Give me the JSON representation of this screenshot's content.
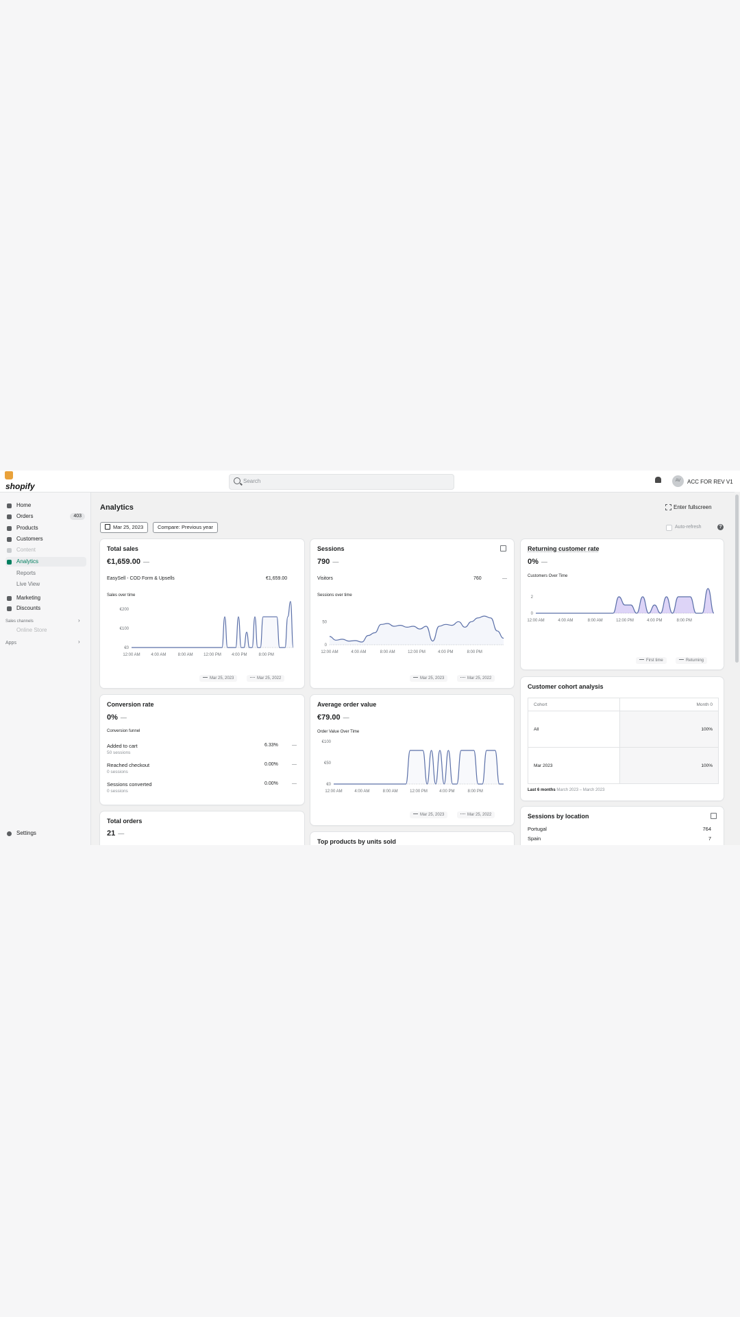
{
  "topbar": {
    "logo_text": "shopify",
    "search_placeholder": "Search",
    "avatar_initials": "AV",
    "store_name": "ACC FOR REV V1"
  },
  "sidebar": {
    "items": [
      {
        "label": "Home",
        "icon": "home-icon"
      },
      {
        "label": "Orders",
        "icon": "orders-icon",
        "badge": "403"
      },
      {
        "label": "Products",
        "icon": "tag-icon"
      },
      {
        "label": "Customers",
        "icon": "person-icon"
      },
      {
        "label": "Content",
        "icon": "content-icon"
      },
      {
        "label": "Analytics",
        "icon": "bar-chart-icon"
      },
      {
        "label": "Marketing",
        "icon": "target-icon"
      },
      {
        "label": "Discounts",
        "icon": "discount-icon"
      }
    ],
    "analytics_sub": [
      "Reports",
      "Live View"
    ],
    "sales_channels_label": "Sales channels",
    "online_store": "Online Store",
    "apps_label": "Apps",
    "settings": "Settings"
  },
  "header": {
    "title": "Analytics",
    "fullscreen": "Enter fullscreen",
    "date_button": "Mar 25, 2023",
    "compare_button": "Compare: Previous year",
    "auto_refresh": "Auto-refresh",
    "help": "?"
  },
  "legend": {
    "current": "Mar 25, 2023",
    "previous": "Mar 25, 2022"
  },
  "returning_legend": {
    "first": "First time",
    "returning": "Returning"
  },
  "total_sales": {
    "title": "Total sales",
    "value": "€1,659.00",
    "dash": "—",
    "source_label": "EasySell - COD Form & Upsells",
    "source_value": "€1,659.00",
    "chart_title": "Sales over time"
  },
  "sessions": {
    "title": "Sessions",
    "value": "790",
    "dash": "—",
    "visitors_label": "Visitors",
    "visitors_value": "760",
    "chart_title": "Sessions over time"
  },
  "returning": {
    "title": "Returning customer rate",
    "value": "0%",
    "dash": "—",
    "chart_title": "Customers Over Time"
  },
  "conversion": {
    "title": "Conversion rate",
    "value": "0%",
    "dash": "—",
    "funnel_title": "Conversion funnel",
    "rows": [
      {
        "label": "Added to cart",
        "sub": "50 sessions",
        "pct": "6.33%",
        "dash": "—"
      },
      {
        "label": "Reached checkout",
        "sub": "0 sessions",
        "pct": "0.00%",
        "dash": "—"
      },
      {
        "label": "Sessions converted",
        "sub": "0 sessions",
        "pct": "0.00%",
        "dash": "—"
      }
    ]
  },
  "aov": {
    "title": "Average order value",
    "value": "€79.00",
    "dash": "—",
    "chart_title": "Order Value Over Time"
  },
  "cohort": {
    "title": "Customer cohort analysis",
    "col_cohort": "Cohort",
    "col_month": "Month 0",
    "rows": [
      {
        "label": "All",
        "value": "100%"
      },
      {
        "label": "Mar 2023",
        "value": "100%"
      }
    ],
    "footer_bold": "Last 6 months",
    "footer_range": "March 2023 – March 2023"
  },
  "total_orders": {
    "title": "Total orders",
    "value": "21",
    "dash": "—"
  },
  "top_products": {
    "title": "Top products by units sold"
  },
  "sessions_location": {
    "title": "Sessions by location",
    "rows": [
      {
        "label": "Portugal",
        "value": "764"
      },
      {
        "label": "Spain",
        "value": "7"
      }
    ]
  },
  "chart_data": [
    {
      "type": "line",
      "title": "Sales over time",
      "x": [
        "12:00 AM",
        "4:00 AM",
        "8:00 AM",
        "12:00 PM",
        "4:00 PM",
        "8:00 PM"
      ],
      "y_ticks": [
        "€200",
        "€100",
        "€0"
      ],
      "ylim": [
        0,
        200
      ],
      "series": [
        {
          "name": "Mar 25, 2023",
          "values": [
            0,
            0,
            0,
            0,
            0,
            0,
            0,
            0,
            0,
            0,
            0,
            0,
            0,
            0,
            0,
            0,
            0,
            0,
            0,
            0,
            0,
            0,
            0,
            0,
            0,
            0,
            0,
            0,
            0,
            0,
            0,
            0,
            0,
            0,
            160,
            0,
            0,
            0,
            0,
            160,
            0,
            0,
            80,
            0,
            0,
            160,
            0,
            0,
            160,
            160,
            160,
            160,
            160,
            160,
            0,
            0,
            0,
            160,
            240,
            0
          ]
        },
        {
          "name": "Mar 25, 2022",
          "values": []
        }
      ]
    },
    {
      "type": "line",
      "title": "Sessions over time",
      "x": [
        "12:00 AM",
        "4:00 AM",
        "8:00 AM",
        "12:00 PM",
        "4:00 PM",
        "8:00 PM"
      ],
      "y_ticks": [
        "50",
        "0"
      ],
      "ylim": [
        0,
        80
      ],
      "series": [
        {
          "name": "Mar 25, 2023",
          "values": [
            18,
            10,
            12,
            8,
            9,
            6,
            20,
            26,
            44,
            46,
            40,
            42,
            38,
            40,
            34,
            40,
            8,
            40,
            44,
            42,
            50,
            38,
            50,
            58,
            62,
            58,
            30,
            14
          ]
        },
        {
          "name": "Mar 25, 2022",
          "values": []
        }
      ]
    },
    {
      "type": "area",
      "title": "Customers Over Time",
      "x": [
        "12:00 AM",
        "4:00 AM",
        "8:00 AM",
        "12:00 PM",
        "4:00 PM",
        "8:00 PM"
      ],
      "y_ticks": [
        "2",
        "0"
      ],
      "ylim": [
        0,
        3
      ],
      "series": [
        {
          "name": "First time",
          "values": [
            0,
            0,
            0,
            0,
            0,
            0,
            0,
            0,
            0,
            0,
            0,
            0,
            0,
            0,
            2,
            1,
            1,
            0,
            2,
            0,
            1,
            0,
            2,
            0,
            2,
            2,
            2,
            0,
            0,
            3,
            0
          ]
        },
        {
          "name": "Returning",
          "values": []
        }
      ]
    },
    {
      "type": "line",
      "title": "Order Value Over Time",
      "x": [
        "12:00 AM",
        "4:00 AM",
        "8:00 AM",
        "12:00 PM",
        "4:00 PM",
        "8:00 PM"
      ],
      "y_ticks": [
        "€100",
        "€50",
        "€0"
      ],
      "ylim": [
        0,
        100
      ],
      "series": [
        {
          "name": "Mar 25, 2023",
          "values": [
            0,
            0,
            0,
            0,
            0,
            0,
            0,
            0,
            0,
            0,
            0,
            0,
            0,
            0,
            0,
            0,
            0,
            0,
            79,
            79,
            79,
            79,
            0,
            79,
            0,
            79,
            0,
            79,
            0,
            0,
            79,
            79,
            79,
            79,
            0,
            0,
            79,
            79,
            79,
            0,
            0
          ]
        },
        {
          "name": "Mar 25, 2022",
          "values": []
        }
      ]
    }
  ]
}
